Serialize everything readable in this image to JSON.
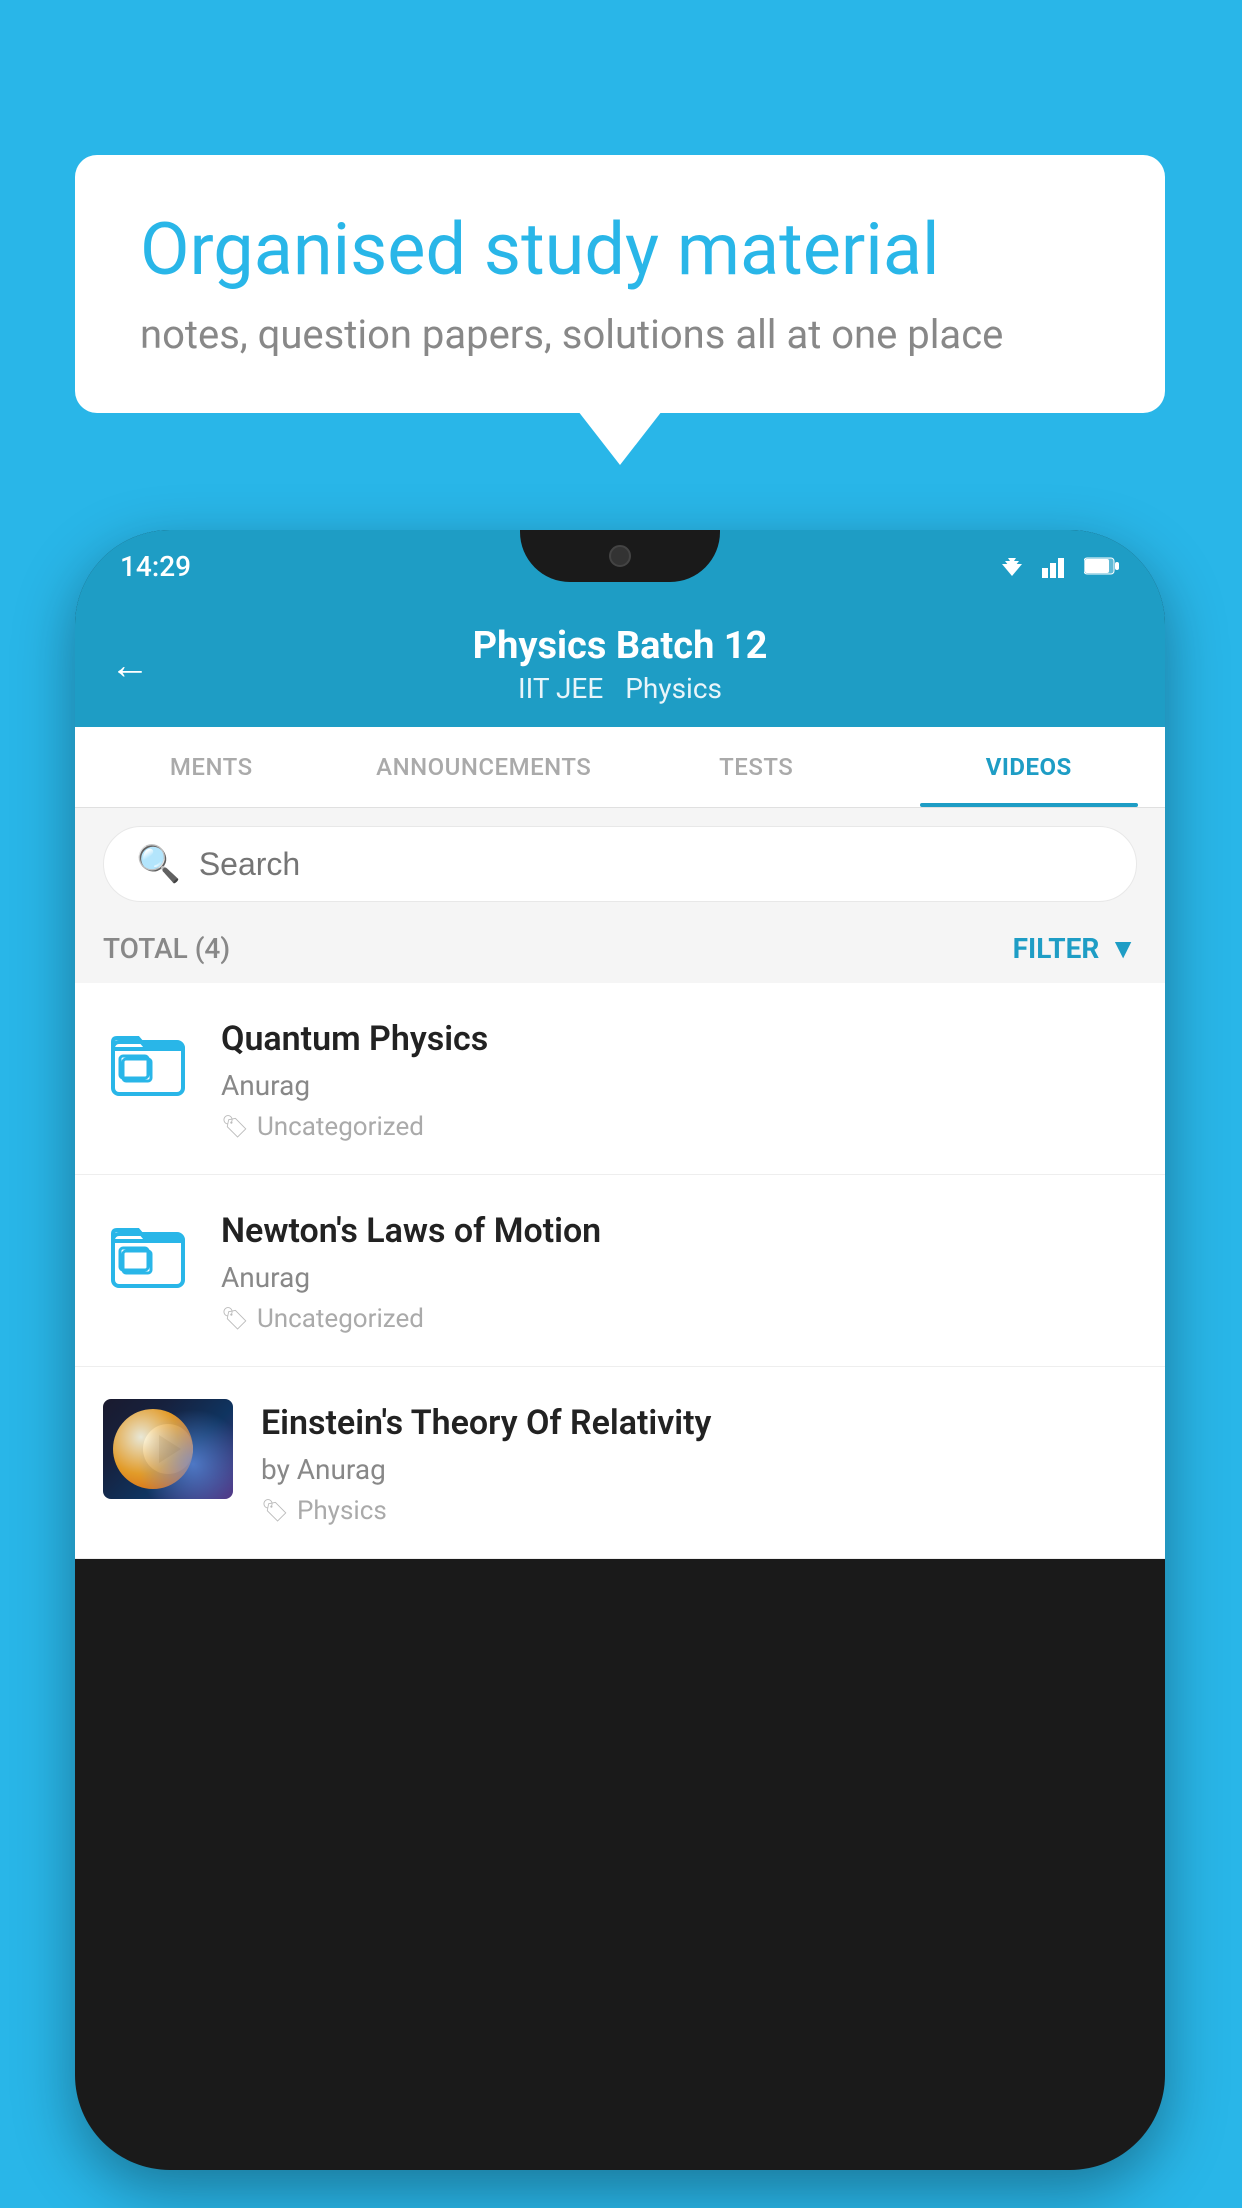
{
  "background_color": "#29B6E8",
  "speech_bubble": {
    "title": "Organised study material",
    "subtitle": "notes, question papers, solutions all at one place"
  },
  "status_bar": {
    "time": "14:29"
  },
  "header": {
    "back_label": "←",
    "title": "Physics Batch 12",
    "subtitle_1": "IIT JEE",
    "subtitle_2": "Physics"
  },
  "tabs": [
    {
      "label": "MENTS",
      "active": false
    },
    {
      "label": "ANNOUNCEMENTS",
      "active": false
    },
    {
      "label": "TESTS",
      "active": false
    },
    {
      "label": "VIDEOS",
      "active": true
    }
  ],
  "search": {
    "placeholder": "Search"
  },
  "filter_bar": {
    "total_label": "TOTAL (4)",
    "filter_label": "FILTER"
  },
  "videos": [
    {
      "title": "Quantum Physics",
      "author": "Anurag",
      "tag": "Uncategorized",
      "has_thumb": false
    },
    {
      "title": "Newton's Laws of Motion",
      "author": "Anurag",
      "tag": "Uncategorized",
      "has_thumb": false
    },
    {
      "title": "Einstein's Theory Of Relativity",
      "author": "by Anurag",
      "tag": "Physics",
      "has_thumb": true
    }
  ]
}
